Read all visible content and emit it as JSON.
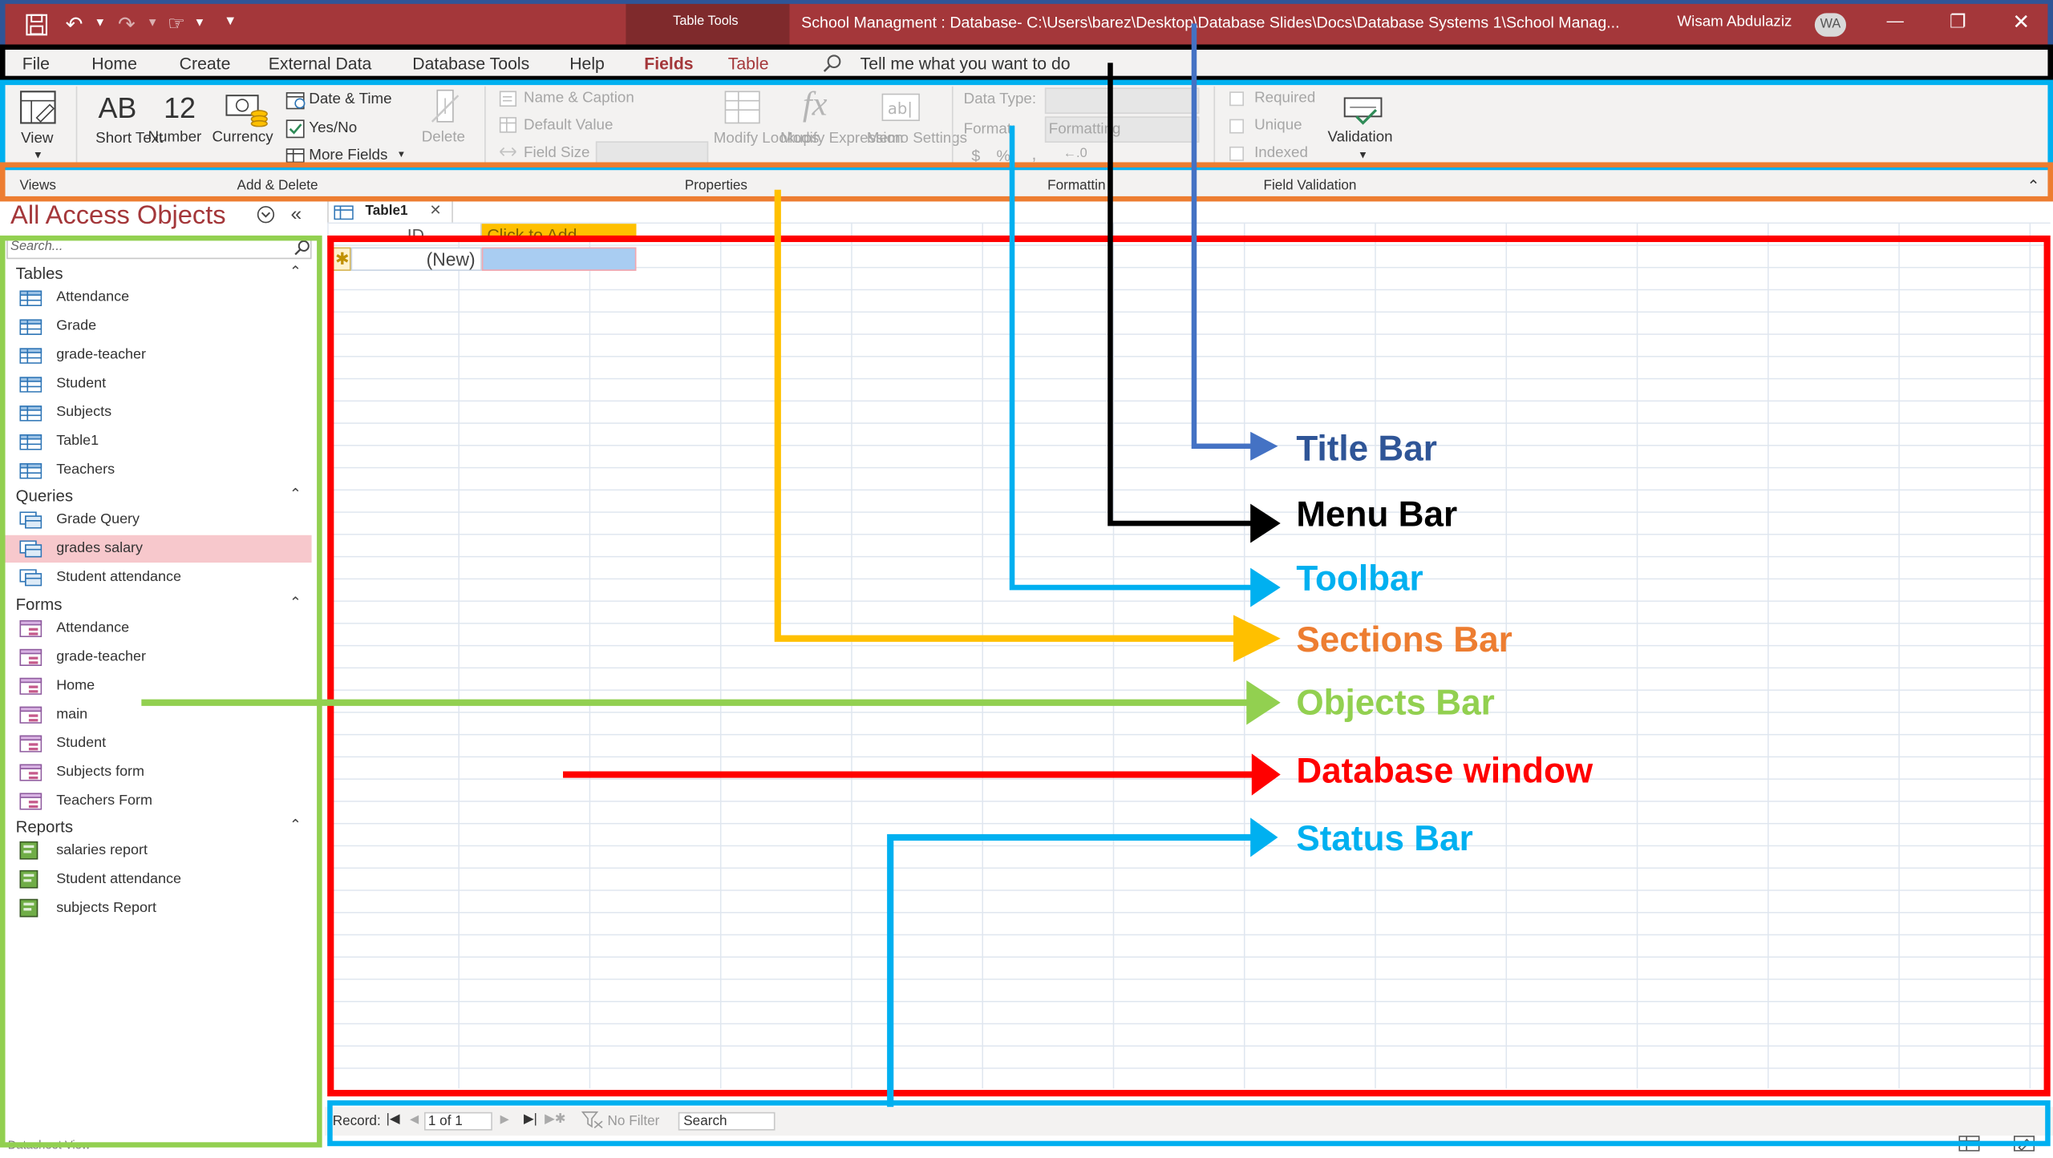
{
  "window": {
    "title": "School Managment : Database- C:\\Users\\barez\\Desktop\\Database Slides\\Docs\\Database Systems 1\\School Manag...",
    "contextual_group": "Table Tools",
    "user_name": "Wisam Abdulaziz",
    "user_initials": "WA"
  },
  "menu": {
    "items": [
      "File",
      "Home",
      "Create",
      "External Data",
      "Database Tools",
      "Help",
      "Fields",
      "Table"
    ],
    "tell_me": "Tell me what you want to do"
  },
  "ribbon": {
    "view": "View",
    "short_text_glyph": "AB",
    "short_text": "Short Text",
    "number_glyph": "12",
    "number": "Number",
    "currency": "Currency",
    "date_time": "Date & Time",
    "yes_no": "Yes/No",
    "more_fields": "More Fields",
    "delete": "Delete",
    "name_caption": "Name & Caption",
    "default_value": "Default Value",
    "field_size": "Field Size",
    "modify_lookups": "Modify Lookups",
    "modify_expression": "Modify Expression",
    "memo_settings": "Memo Settings",
    "data_type": "Data Type:",
    "format": "Format:",
    "formatting": "Formatting",
    "required": "Required",
    "unique": "Unique",
    "indexed": "Indexed",
    "validation": "Validation"
  },
  "sections": [
    "Views",
    "Add & Delete",
    "Properties",
    "Formatting",
    "Field Validation"
  ],
  "nav": {
    "title": "All Access Objects",
    "search_placeholder": "Search...",
    "groups": [
      {
        "name": "Tables",
        "items": [
          "Attendance",
          "Grade",
          "grade-teacher",
          "Student",
          "Subjects",
          "Table1",
          "Teachers"
        ]
      },
      {
        "name": "Queries",
        "items": [
          "Grade Query",
          "grades salary",
          "Student attendance"
        ]
      },
      {
        "name": "Forms",
        "items": [
          "Attendance",
          "grade-teacher",
          "Home",
          "main",
          "Student",
          "Subjects form",
          "Teachers Form"
        ]
      },
      {
        "name": "Reports",
        "items": [
          "salaries report",
          "Student attendance",
          "subjects Report"
        ]
      }
    ]
  },
  "table": {
    "tab_label": "Table1",
    "header_id": "ID",
    "header_add": "Click to Add",
    "new_row": "(New)"
  },
  "status": {
    "record_label": "Record:",
    "record_value": "1 of 1",
    "no_filter": "No Filter",
    "search": "Search",
    "view_name": "Datasheet View"
  },
  "annotations": [
    {
      "label": "Title Bar",
      "color": "#2f5597"
    },
    {
      "label": "Menu Bar",
      "color": "#000000"
    },
    {
      "label": "Toolbar",
      "color": "#00b0f0"
    },
    {
      "label": "Sections Bar",
      "color": "#ed7d31"
    },
    {
      "label": "Objects Bar",
      "color": "#92d050"
    },
    {
      "label": "Database window",
      "color": "#ff0000"
    },
    {
      "label": "Status Bar",
      "color": "#00b0f0"
    }
  ],
  "colors": {
    "access_red": "#a4373a",
    "title_frame": "#2f5597",
    "toolbar_frame": "#00b0f0",
    "sections_frame": "#ed7d31",
    "arrow_yellow": "#ffc000",
    "objects_frame": "#92d050",
    "database_frame": "#ff0000"
  }
}
